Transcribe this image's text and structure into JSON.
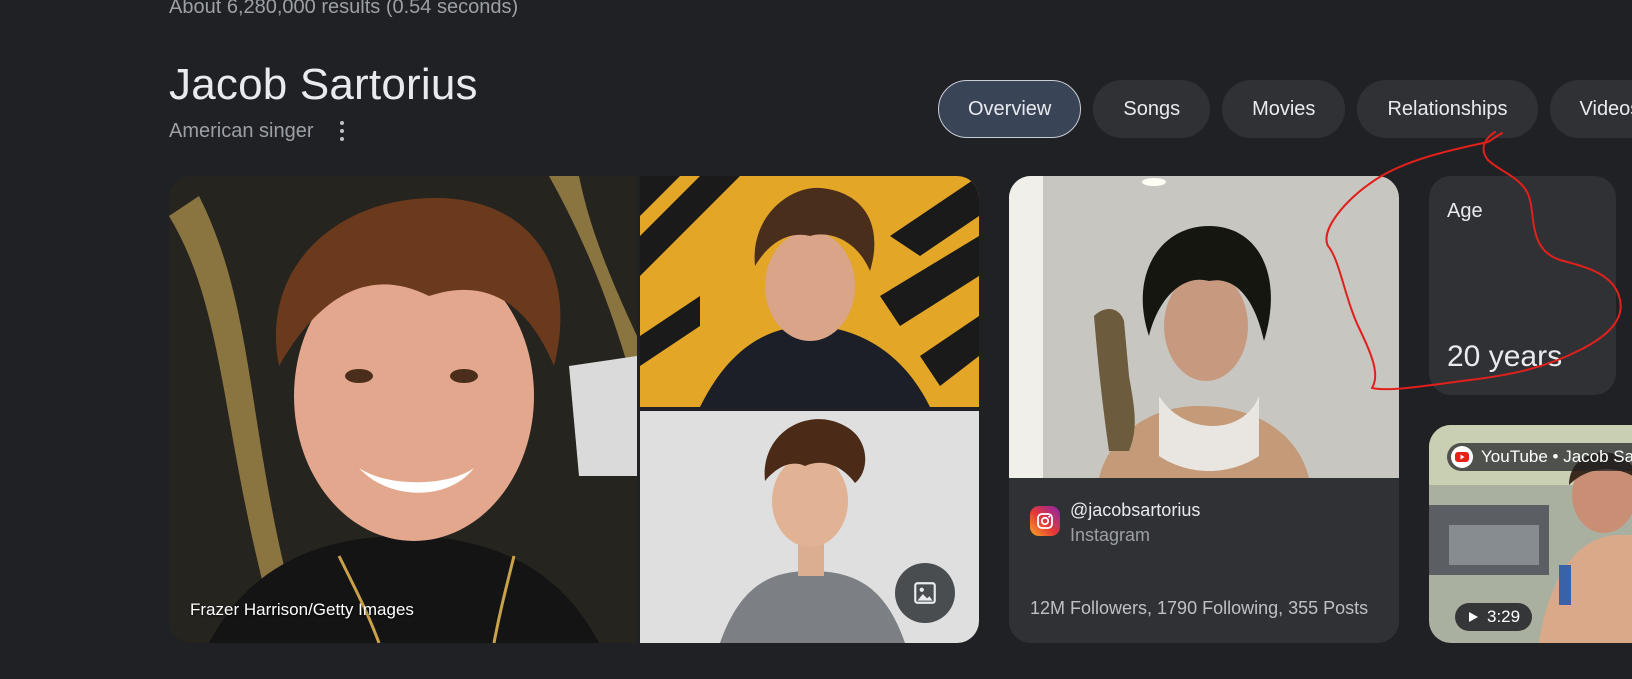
{
  "results": {
    "stats": "About 6,280,000 results (0.54 seconds)"
  },
  "entity": {
    "title": "Jacob Sartorius",
    "subtitle": "American singer"
  },
  "chips": [
    {
      "label": "Overview",
      "active": true
    },
    {
      "label": "Songs",
      "active": false
    },
    {
      "label": "Movies",
      "active": false
    },
    {
      "label": "Relationships",
      "active": false
    },
    {
      "label": "Videos",
      "active": false
    }
  ],
  "images": {
    "credit": "Frazer Harrison/Getty Images"
  },
  "instagram": {
    "handle": "@jacobsartorius",
    "source": "Instagram",
    "stats": "12M Followers, 1790 Following, 355 Posts"
  },
  "age": {
    "label": "Age",
    "value": "20 years"
  },
  "video": {
    "source": "YouTube • Jacob Sartorius",
    "duration": "3:29"
  },
  "colors": {
    "background": "#202124",
    "card": "#303134",
    "annotation": "#e0201c"
  }
}
